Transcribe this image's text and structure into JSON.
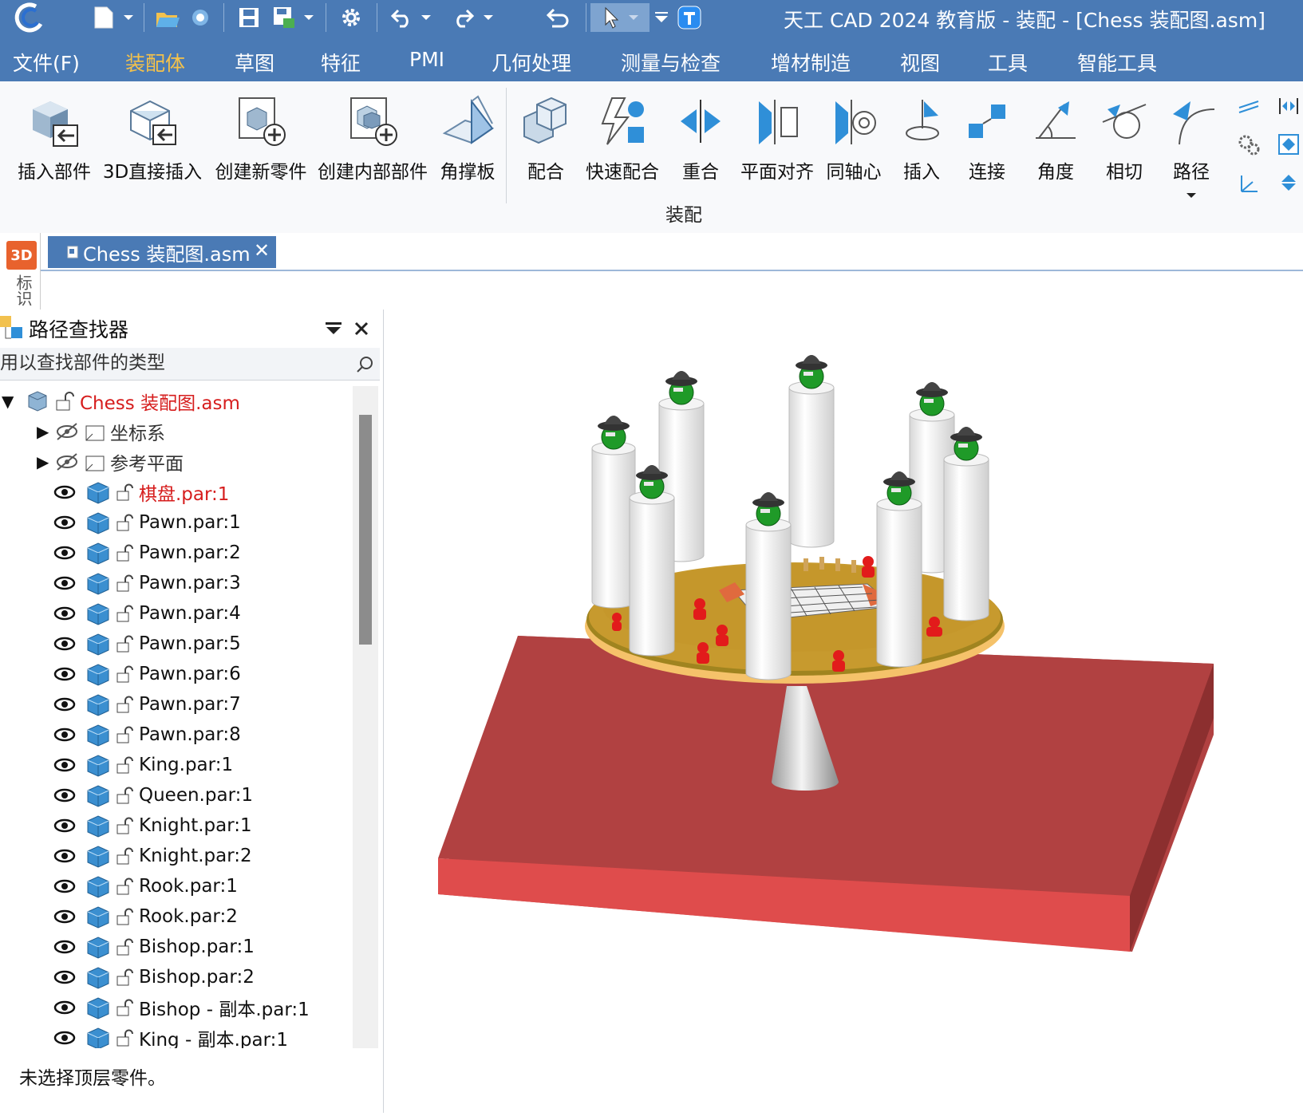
{
  "window": {
    "title": "天工 CAD 2024 教育版 - 装配 - [Chess 装配图.asm]"
  },
  "colors": {
    "titlebar": "#4a7ab5",
    "menu_active": "#f5c24a",
    "tree_red": "#d61d1d",
    "board": "#d24545",
    "table_top": "#c79a2e"
  },
  "quick_access": [
    {
      "name": "app-logo-icon"
    },
    {
      "name": "new-file-icon"
    },
    {
      "name": "open-file-icon"
    },
    {
      "name": "save-icon"
    },
    {
      "name": "settings-icon"
    },
    {
      "name": "undo-icon"
    },
    {
      "name": "redo-icon"
    },
    {
      "name": "select-arrow-icon"
    }
  ],
  "menu": {
    "items": [
      "文件(F)",
      "装配体",
      "草图",
      "特征",
      "PMI",
      "几何处理",
      "测量与检查",
      "增材制造",
      "视图",
      "工具",
      "智能工具"
    ],
    "active_index": 1
  },
  "ribbon": {
    "buttons": [
      "插入部件",
      "3D直接插入",
      "创建新零件",
      "创建内部部件",
      "角撑板",
      "配合",
      "快速配合",
      "重合",
      "平面对齐",
      "同轴心",
      "插入",
      "连接",
      "角度",
      "相切",
      "路径"
    ],
    "group_label": "装配"
  },
  "document_tab": {
    "label": "Chess 装配图.asm",
    "close": "✕"
  },
  "side_tab": {
    "badge": "3D",
    "label": "标识"
  },
  "path_finder": {
    "title": "路径查找器",
    "search_placeholder": "用以查找部件的类型",
    "tree": [
      {
        "label": "Chess 装配图.asm",
        "type": "root",
        "style": "red",
        "expander": "▼"
      },
      {
        "label": "坐标系",
        "type": "folder",
        "style": "gray",
        "expander": "▶",
        "hidden": true
      },
      {
        "label": "参考平面",
        "type": "folder",
        "style": "gray",
        "expander": "▶",
        "hidden": true
      },
      {
        "label": "棋盘.par:1",
        "type": "part",
        "style": "red"
      },
      {
        "label": "Pawn.par:1",
        "type": "part"
      },
      {
        "label": "Pawn.par:2",
        "type": "part"
      },
      {
        "label": "Pawn.par:3",
        "type": "part"
      },
      {
        "label": "Pawn.par:4",
        "type": "part"
      },
      {
        "label": "Pawn.par:5",
        "type": "part"
      },
      {
        "label": "Pawn.par:6",
        "type": "part"
      },
      {
        "label": "Pawn.par:7",
        "type": "part"
      },
      {
        "label": "Pawn.par:8",
        "type": "part"
      },
      {
        "label": "King.par:1",
        "type": "part"
      },
      {
        "label": "Queen.par:1",
        "type": "part"
      },
      {
        "label": "Knight.par:1",
        "type": "part"
      },
      {
        "label": "Knight.par:2",
        "type": "part"
      },
      {
        "label": "Rook.par:1",
        "type": "part"
      },
      {
        "label": "Rook.par:2",
        "type": "part"
      },
      {
        "label": "Bishop.par:1",
        "type": "part"
      },
      {
        "label": "Bishop.par:2",
        "type": "part"
      },
      {
        "label": "Bishop - 副本.par:1",
        "type": "part"
      },
      {
        "label": "King - 副本.par:1",
        "type": "part"
      }
    ],
    "status": "未选择顶层零件。"
  }
}
